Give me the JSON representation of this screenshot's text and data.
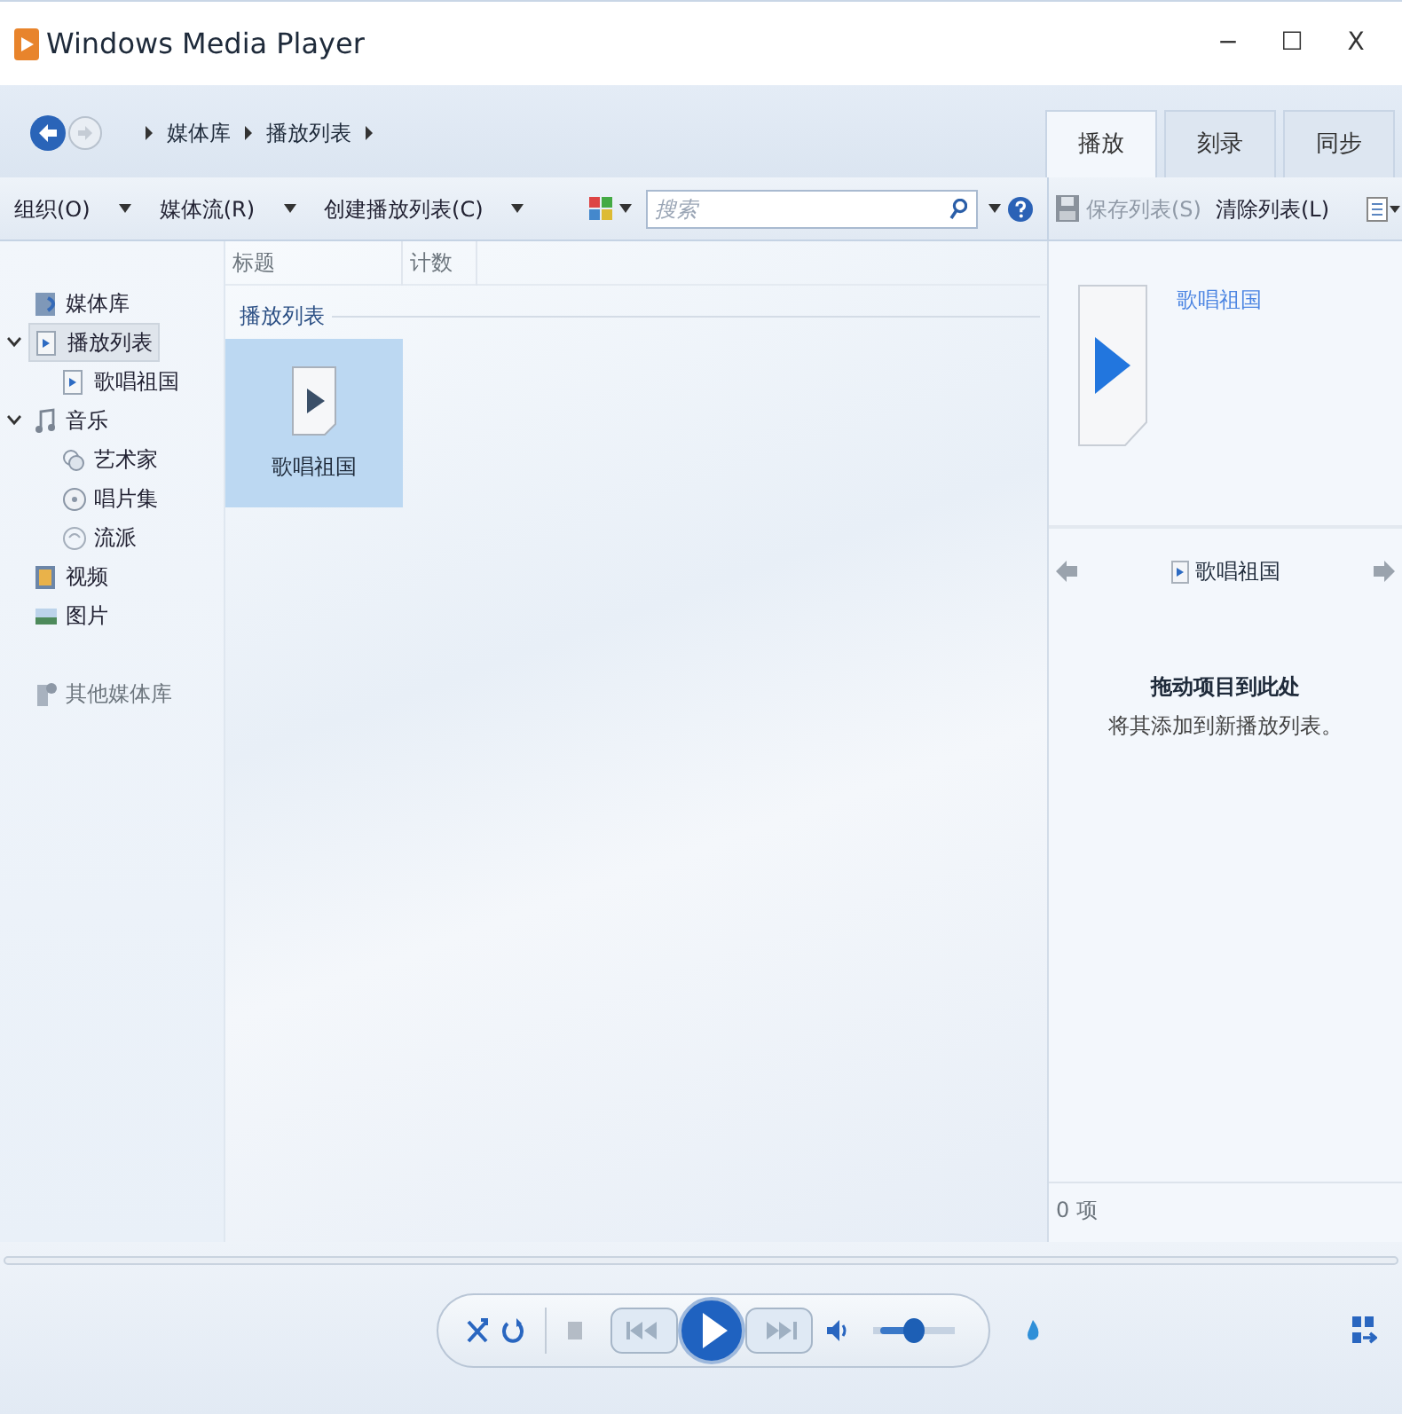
{
  "window": {
    "title": "Windows Media Player",
    "controls": [
      "−",
      "☐",
      "X"
    ]
  },
  "breadcrumb": [
    "媒体库",
    "播放列表"
  ],
  "tabs": [
    {
      "label": "播放",
      "selected": true
    },
    {
      "label": "刻录",
      "selected": false
    },
    {
      "label": "同步",
      "selected": false
    }
  ],
  "toolbar": {
    "menus": [
      "组织(O)",
      "媒体流(R)",
      "创建播放列表(C)"
    ],
    "search": {
      "placeholder": "搜索"
    }
  },
  "list_toolbar": {
    "save_button": {
      "label": "保存列表(S)",
      "disabled": true
    },
    "clear_button": {
      "label": "清除列表(L)",
      "disabled": false
    }
  },
  "navigation": [
    {
      "label": "媒体库",
      "selected": false
    },
    {
      "label": "播放列表",
      "selected": true,
      "expanded": true,
      "children": [
        {
          "label": "歌唱祖国",
          "selected": false
        }
      ]
    },
    {
      "label": "音乐",
      "selected": false,
      "expanded": true,
      "children": [
        {
          "label": "艺术家",
          "selected": false
        },
        {
          "label": "唱片集",
          "selected": false
        },
        {
          "label": "流派",
          "selected": false
        }
      ]
    },
    {
      "label": "视频",
      "selected": false
    },
    {
      "label": "图片",
      "selected": false
    }
  ],
  "other_libraries": "其他媒体库",
  "columns": [
    "标题",
    "计数"
  ],
  "group": "播放列表",
  "items": [
    {
      "label": "歌唱祖国",
      "selected": true
    }
  ],
  "list_pane": {
    "title": "歌唱祖国",
    "playlist_title": "歌唱祖国",
    "drop_title": "拖动项目到此处",
    "drop_hint": "将其添加到新播放列表。",
    "count": "0 项"
  },
  "player": {
    "volume": {
      "level": 0.5
    }
  }
}
